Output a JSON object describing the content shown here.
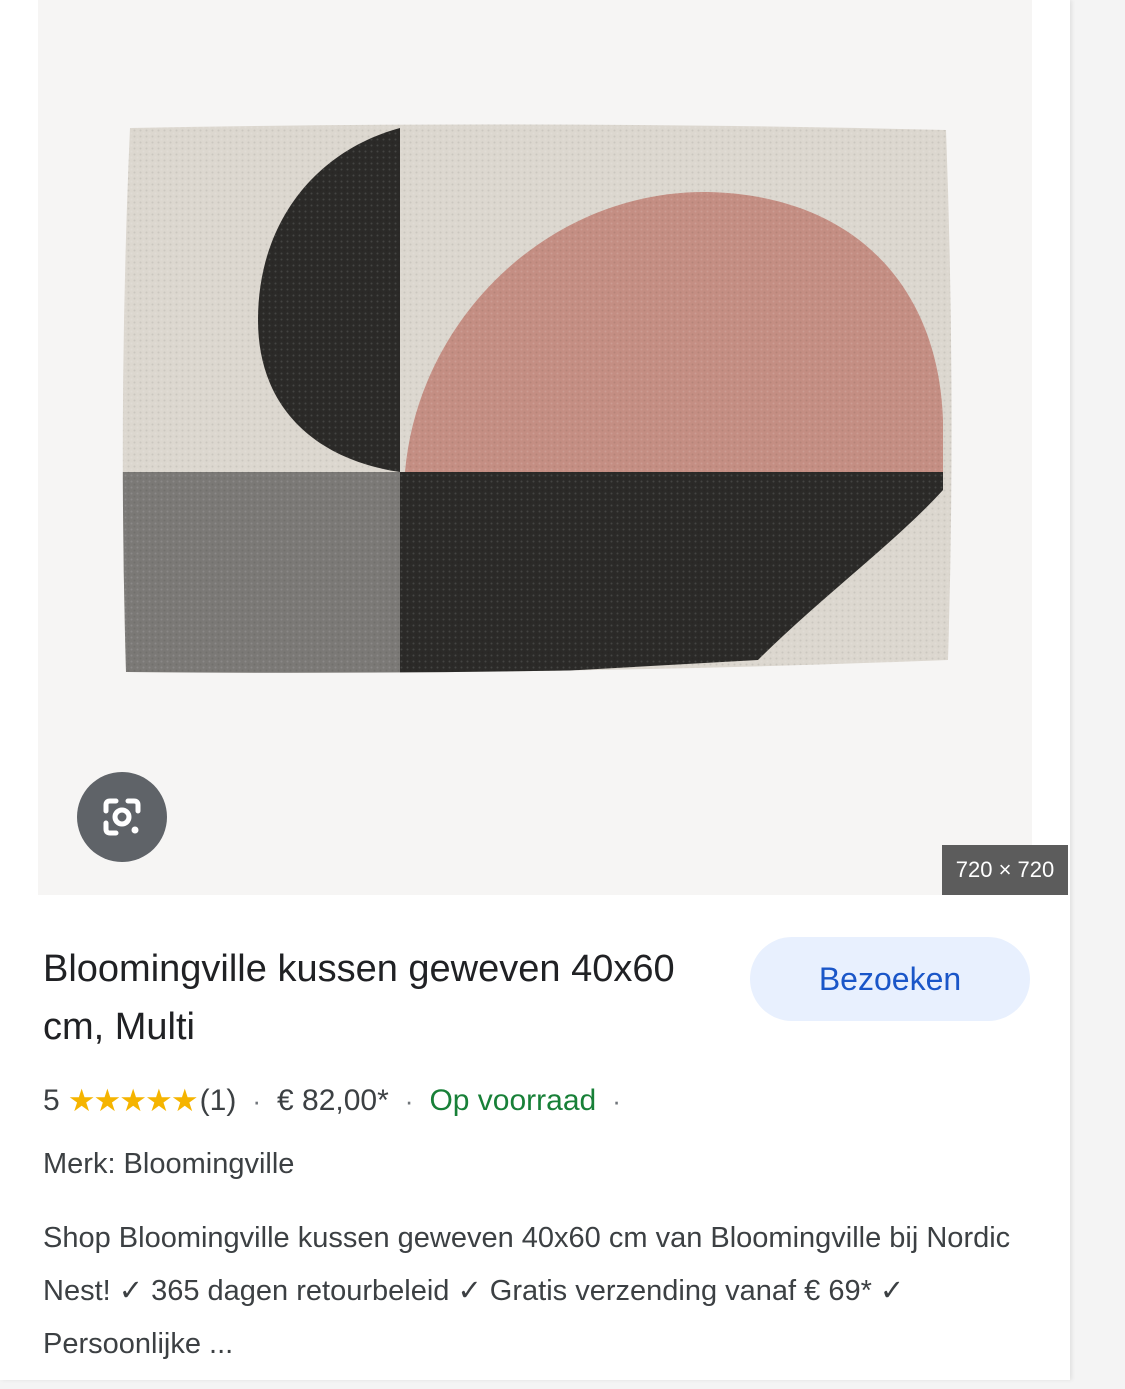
{
  "image": {
    "dimensions_label": "720 × 720",
    "lens_icon": "google-lens-icon",
    "colors": {
      "cream": "#dcd7cf",
      "pink": "#c48e83",
      "charcoal": "#2b2a28",
      "grey": "#7b7976"
    }
  },
  "product": {
    "title": "Bloomingville kussen geweven 40x60 cm, Multi",
    "visit_label": "Bezoeken",
    "rating_value": "5",
    "stars": "★★★★★",
    "review_count": "(1)",
    "separator": "·",
    "price": "€ 82,00*",
    "stock_status": "Op voorraad",
    "brand_line": "Merk: Bloomingville",
    "description": "Shop Bloomingville kussen geweven 40x60 cm van Bloomingville bij Nordic Nest! ✓ 365 dagen retourbeleid ✓ Gratis verzending vanaf € 69* ✓ Persoonlijke ..."
  },
  "theme": {
    "accent_blue": "#1a56c8",
    "button_bg": "#e8f0fe",
    "stock_green": "#188038",
    "star_color": "#f5b400"
  }
}
